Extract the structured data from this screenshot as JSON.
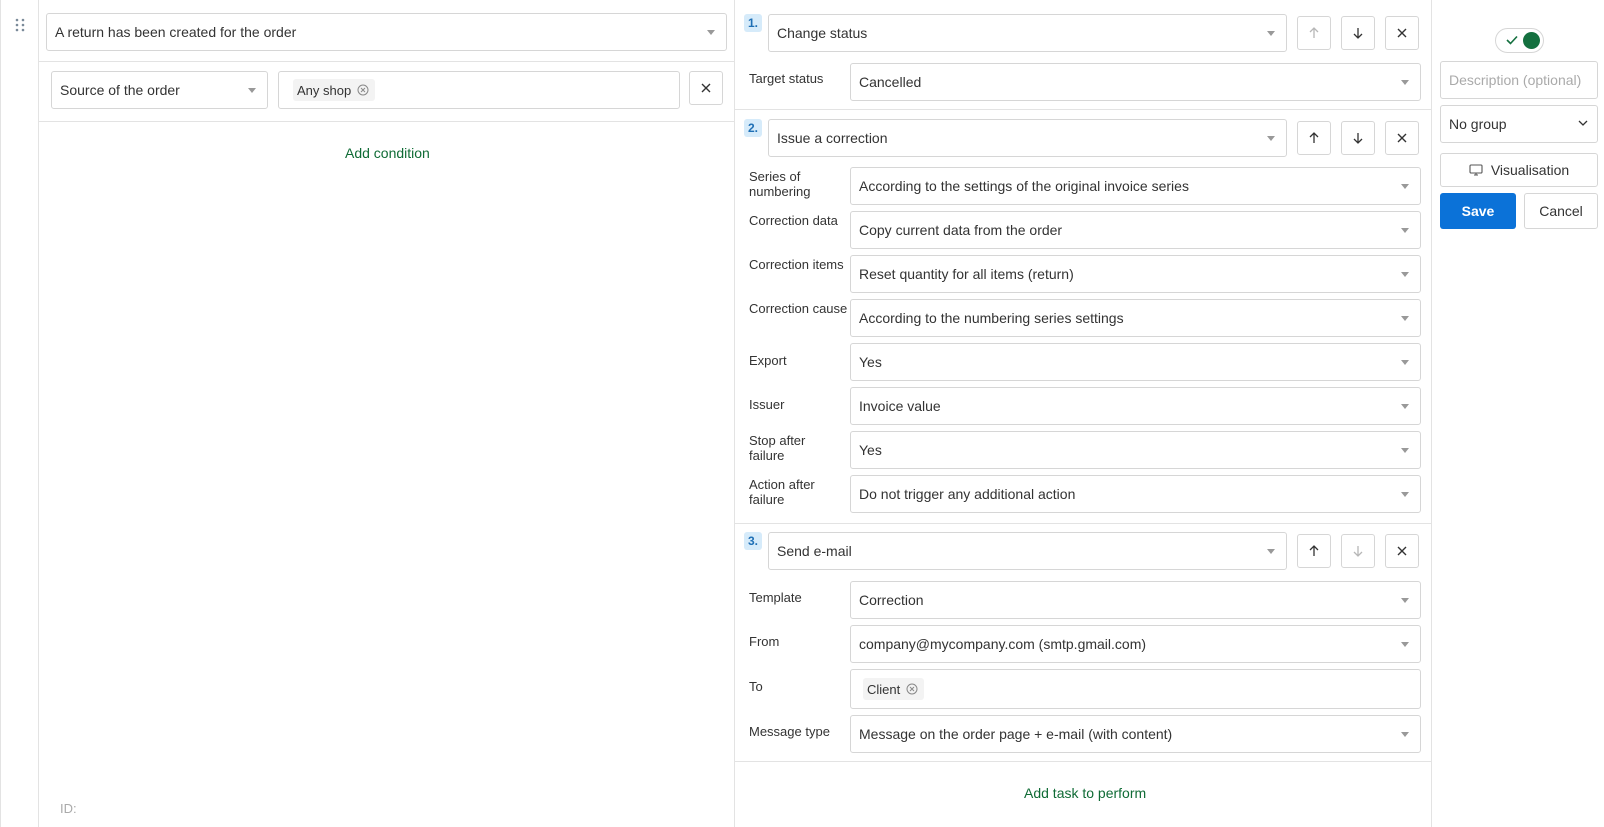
{
  "event": {
    "trigger": "A return has been created for the order"
  },
  "condition": {
    "field": "Source of the order",
    "tags": [
      "Any shop"
    ],
    "add_label": "Add condition",
    "id_label": "ID:"
  },
  "tasks": {
    "step1": {
      "number": "1.",
      "action": "Change status",
      "rows": [
        {
          "label": "Target status",
          "value": "Cancelled"
        }
      ]
    },
    "step2": {
      "number": "2.",
      "action": "Issue a correction",
      "rows": [
        {
          "label": "Series of numbering",
          "value": "According to the settings of the original invoice series"
        },
        {
          "label": "Correction data",
          "value": "Copy current data from the order"
        },
        {
          "label": "Correction items",
          "value": "Reset quantity for all items (return)"
        },
        {
          "label": "Correction cause",
          "value": "According to the numbering series settings"
        },
        {
          "label": "Export",
          "value": "Yes"
        },
        {
          "label": "Issuer",
          "value": "Invoice value"
        },
        {
          "label": "Stop after failure",
          "value": "Yes"
        },
        {
          "label": "Action after failure",
          "value": "Do not trigger any additional action"
        }
      ]
    },
    "step3": {
      "number": "3.",
      "action": "Send e-mail",
      "rows": [
        {
          "label": "Template",
          "value": "Correction"
        },
        {
          "label": "From",
          "value": "company@mycompany.com (smtp.gmail.com)"
        },
        {
          "label": "To",
          "tag": "Client"
        },
        {
          "label": "Message type",
          "value": "Message on the order page + e-mail (with content)"
        }
      ]
    },
    "add_label": "Add task to perform"
  },
  "sidebar": {
    "enabled": true,
    "description_placeholder": "Description (optional)",
    "group": "No group",
    "visualisation_label": "Visualisation",
    "save_label": "Save",
    "cancel_label": "Cancel"
  },
  "colors": {
    "accent_green": "#14703f",
    "primary_blue": "#0b72d8",
    "step_badge_bg": "#d6ebfa",
    "border": "#d6d6d6"
  },
  "icons": [
    "drag-handle-icon",
    "caret-down-icon",
    "close-icon",
    "arrow-up-icon",
    "arrow-down-icon",
    "tag-remove-icon",
    "check-icon",
    "monitor-icon"
  ]
}
